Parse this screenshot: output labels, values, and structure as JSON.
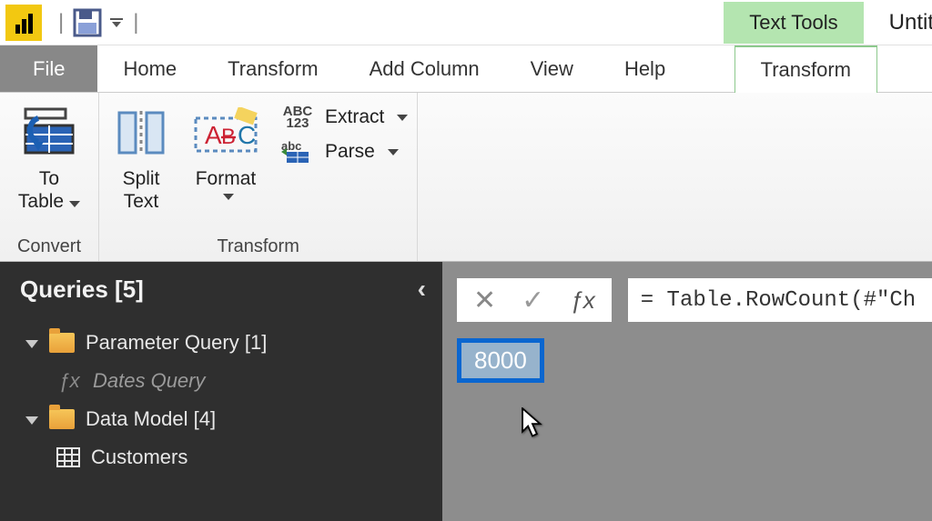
{
  "titlebar": {
    "context_tab": "Text Tools",
    "doc_title": "Untit"
  },
  "tabs": {
    "file": "File",
    "home": "Home",
    "transform1": "Transform",
    "addcolumn": "Add Column",
    "view": "View",
    "help": "Help",
    "transform2": "Transform"
  },
  "ribbon": {
    "group_convert": "Convert",
    "group_transform": "Transform",
    "to_table_line1": "To",
    "to_table_line2": "Table",
    "split_line1": "Split",
    "split_line2": "Text",
    "format": "Format",
    "extract": "Extract",
    "parse": "Parse",
    "extract_prefix": "ABC\n123",
    "parse_prefix": "abc"
  },
  "queries": {
    "title": "Queries [5]",
    "folder1": "Parameter Query [1]",
    "item_fx": "Dates Query",
    "folder2": "Data Model [4]",
    "item_customers": "Customers"
  },
  "formula": {
    "text": "= Table.RowCount(#\"Ch"
  },
  "result": {
    "value": "8000"
  }
}
